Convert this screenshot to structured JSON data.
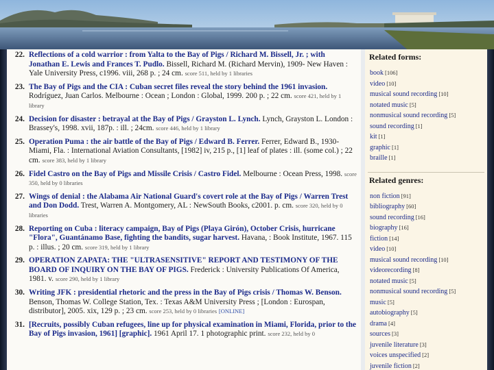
{
  "results": [
    {
      "num": "22.",
      "title": "Reflections of a cold warrior : from Yalta to the Bay of Pigs / Richard M. Bissell, Jr. ; with Jonathan E. Lewis and Frances T. Pudlo.",
      "desc": "Bissell, Richard M. (Richard Mervin), 1909- New Haven : Yale University Press, c1996. viii, 268 p. ; 24 cm.",
      "meta": "score 511, held by 1 libraries",
      "online": ""
    },
    {
      "num": "23.",
      "title": "The Bay of Pigs and the CIA : Cuban secret files reveal the story behind the 1961 invasion.",
      "desc": "Rodríguez, Juan Carlos. Melbourne : Ocean ; London : Global, 1999. 200 p. ; 22 cm.",
      "meta": "score 421, held by 1 library",
      "online": ""
    },
    {
      "num": "24.",
      "title": "Decision for disaster : betrayal at the Bay of Pigs / Grayston L. Lynch.",
      "desc": "Lynch, Grayston L. London : Brassey's, 1998. xvii, 187p. : ill. ; 24cm.",
      "meta": "score 446, held by 1 library",
      "online": ""
    },
    {
      "num": "25.",
      "title": "Operation Puma : the air battle of the Bay of Pigs / Edward B. Ferrer.",
      "desc": "Ferrer, Edward B., 1930- Miami, Fla. : International Aviation Consultants, [1982] iv, 215 p., [1] leaf of plates : ill. (some col.) ; 22 cm.",
      "meta": "score 383, held by 1 library",
      "online": ""
    },
    {
      "num": "26.",
      "title": "Fidel Castro on the Bay of Pigs and Missile Crisis / Castro Fidel.",
      "desc": "Melbourne : Ocean Press, 1998.",
      "meta": "score 350, held by 0 libraries",
      "online": ""
    },
    {
      "num": "27.",
      "title": "Wings of denial : the Alabama Air National Guard's covert role at the Bay of Pigs / Warren Trest and Don Dodd.",
      "desc": "Trest, Warren A. Montgomery, AL : NewSouth Books, c2001. p. cm.",
      "meta": "score 320, held by 0 libraries",
      "online": ""
    },
    {
      "num": "28.",
      "title": "Reporting on Cuba : literacy campaign, Bay of Pigs (Playa Girón), October Crisis, hurricane \"Flora\", Guantánamo Base, fighting the bandits, sugar harvest.",
      "desc": "Havana, : Book Institute, 1967. 115 p. : illus. ; 20 cm.",
      "meta": "score 319, held by 1 library",
      "online": ""
    },
    {
      "num": "29.",
      "title": "OPERATION ZAPATA: THE \"ULTRASENSITIVE\" REPORT AND TESTIMONY OF THE BOARD OF INQUIRY ON THE BAY OF PIGS.",
      "desc": "Frederick : University Publications Of America, 1981. v.",
      "meta": "score 290, held by 1 library",
      "online": ""
    },
    {
      "num": "30.",
      "title": "Writing JFK : presidential rhetoric and the press in the Bay of Pigs crisis / Thomas W. Benson.",
      "desc": "Benson, Thomas W. College Station, Tex. : Texas A&M University Press ; [London : Eurospan, distributor], 2005. xix, 129 p. ; 23 cm.",
      "meta": "score 253, held by 0 libraries",
      "online": "[ONLINE]"
    },
    {
      "num": "31.",
      "title": "[Recruits, possibly Cuban refugees, line up for physical examination in Miami, Florida, prior to the Bay of Pigs invasion, 1961] [graphic].",
      "desc": "1961 April 17. 1 photographic print.",
      "meta": "score 232, held by 0",
      "online": ""
    }
  ],
  "sidebar": {
    "forms_heading": "Related forms:",
    "forms": [
      {
        "label": "book",
        "count": "[106]"
      },
      {
        "label": "video",
        "count": "[10]"
      },
      {
        "label": "musical sound recording",
        "count": "[10]"
      },
      {
        "label": "notated music",
        "count": "[5]"
      },
      {
        "label": "nonmusical sound recording",
        "count": "[5]"
      },
      {
        "label": "sound recording",
        "count": "[1]"
      },
      {
        "label": "kit",
        "count": "[1]"
      },
      {
        "label": "graphic",
        "count": "[1]"
      },
      {
        "label": "braille",
        "count": "[1]"
      }
    ],
    "genres_heading": "Related genres:",
    "genres": [
      {
        "label": "non fiction",
        "count": "[91]"
      },
      {
        "label": "bibliography",
        "count": "[60]"
      },
      {
        "label": "sound recording",
        "count": "[16]"
      },
      {
        "label": "biography",
        "count": "[16]"
      },
      {
        "label": "fiction",
        "count": "[14]"
      },
      {
        "label": "video",
        "count": "[10]"
      },
      {
        "label": "musical sound recording",
        "count": "[10]"
      },
      {
        "label": "videorecording",
        "count": "[8]"
      },
      {
        "label": "notated music",
        "count": "[5]"
      },
      {
        "label": "nonmusical sound recording",
        "count": "[5]"
      },
      {
        "label": "music",
        "count": "[5]"
      },
      {
        "label": "autobiography",
        "count": "[5]"
      },
      {
        "label": "drama",
        "count": "[4]"
      },
      {
        "label": "sources",
        "count": "[3]"
      },
      {
        "label": "juvenile literature",
        "count": "[3]"
      },
      {
        "label": "voices unspecified",
        "count": "[2]"
      },
      {
        "label": "juvenile fiction",
        "count": "[2]"
      }
    ]
  },
  "colors": {
    "link": "#1b2a8a",
    "page": "#fbfaf6",
    "sidebar": "#fbf5e6",
    "frame": "#1e2a40"
  }
}
